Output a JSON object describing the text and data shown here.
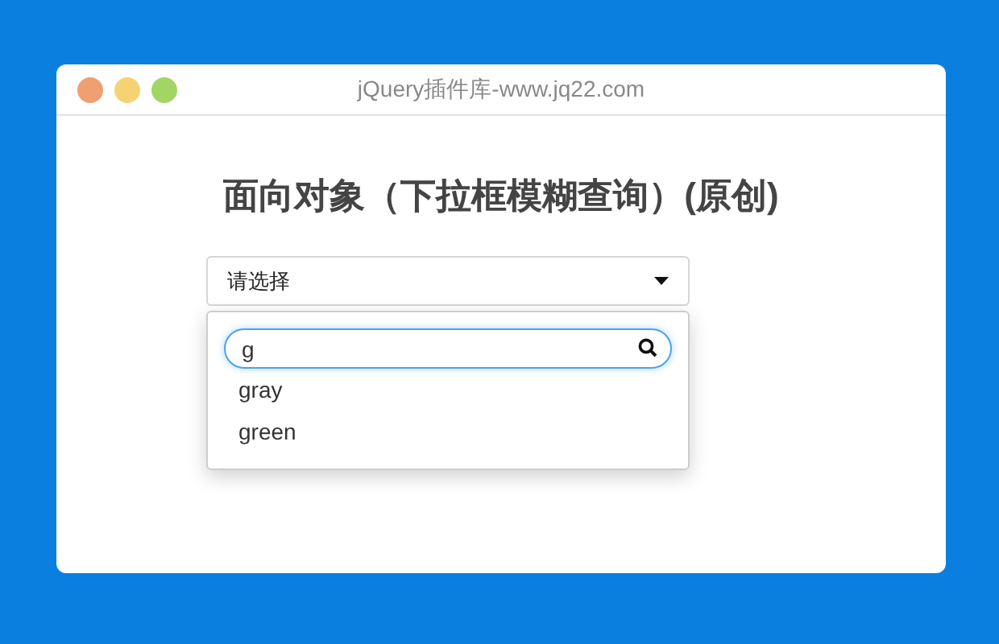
{
  "window": {
    "title": "jQuery插件库-www.jq22.com"
  },
  "heading": "面向对象（下拉框模糊查询）(原创)",
  "select": {
    "value": "请选择",
    "expanded": true,
    "search": {
      "value": "g"
    },
    "options": [
      {
        "label": "gray"
      },
      {
        "label": "green"
      }
    ]
  }
}
